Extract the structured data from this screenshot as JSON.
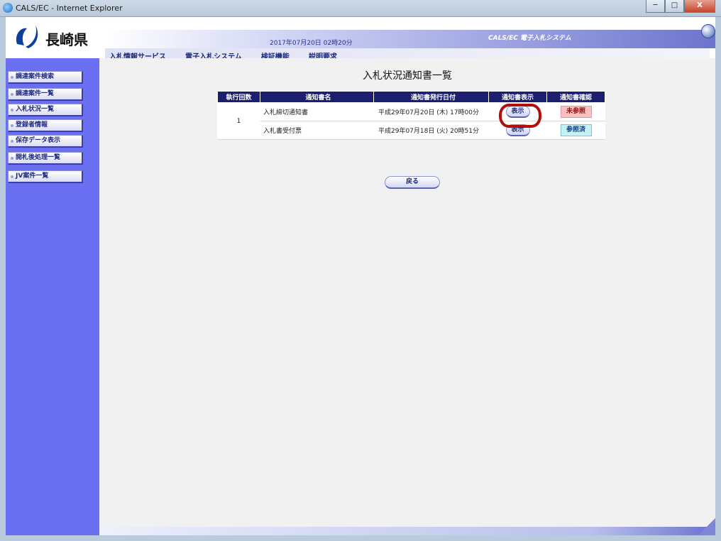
{
  "window": {
    "title": "CALS/EC - Internet Explorer",
    "controls": [
      "─",
      "□",
      "X"
    ]
  },
  "header": {
    "logo_text": "長崎県",
    "datetime": "2017年07月20日 02時20分",
    "system_name": "CALS/EC 電子入札システム"
  },
  "menu": {
    "items": [
      "入札情報サービス",
      "電子入札システム",
      "検証機能",
      "説明要求"
    ]
  },
  "sidebar": {
    "items": [
      {
        "label": "調達案件検索"
      },
      {
        "label": "調達案件一覧"
      },
      {
        "label": "入札状況一覧"
      },
      {
        "label": "登録者情報"
      },
      {
        "label": "保存データ表示"
      },
      {
        "label": "開札後処理一覧"
      },
      {
        "label": "JV案件一覧"
      }
    ]
  },
  "main": {
    "title": "入札状況通知書一覧",
    "table": {
      "headers": [
        "執行回数",
        "通知書名",
        "通知書発行日付",
        "通知書表示",
        "通知書確認"
      ],
      "round": "1",
      "rows": [
        {
          "name": "入札締切通知書",
          "date": "平成29年07月20日 (木) 17時00分",
          "show": "表示",
          "status": "未参照"
        },
        {
          "name": "入札書受付票",
          "date": "平成29年07月18日 (火) 20時51分",
          "show": "表示",
          "status": "参照済"
        }
      ]
    },
    "back_label": "戻る"
  },
  "colors": {
    "sidebar_bg": "#6b6ff2",
    "table_header_bg": "#1c1f6f",
    "highlight": "#b10d0d",
    "unread": "#f9c2c0",
    "read": "#c7f1f5"
  }
}
